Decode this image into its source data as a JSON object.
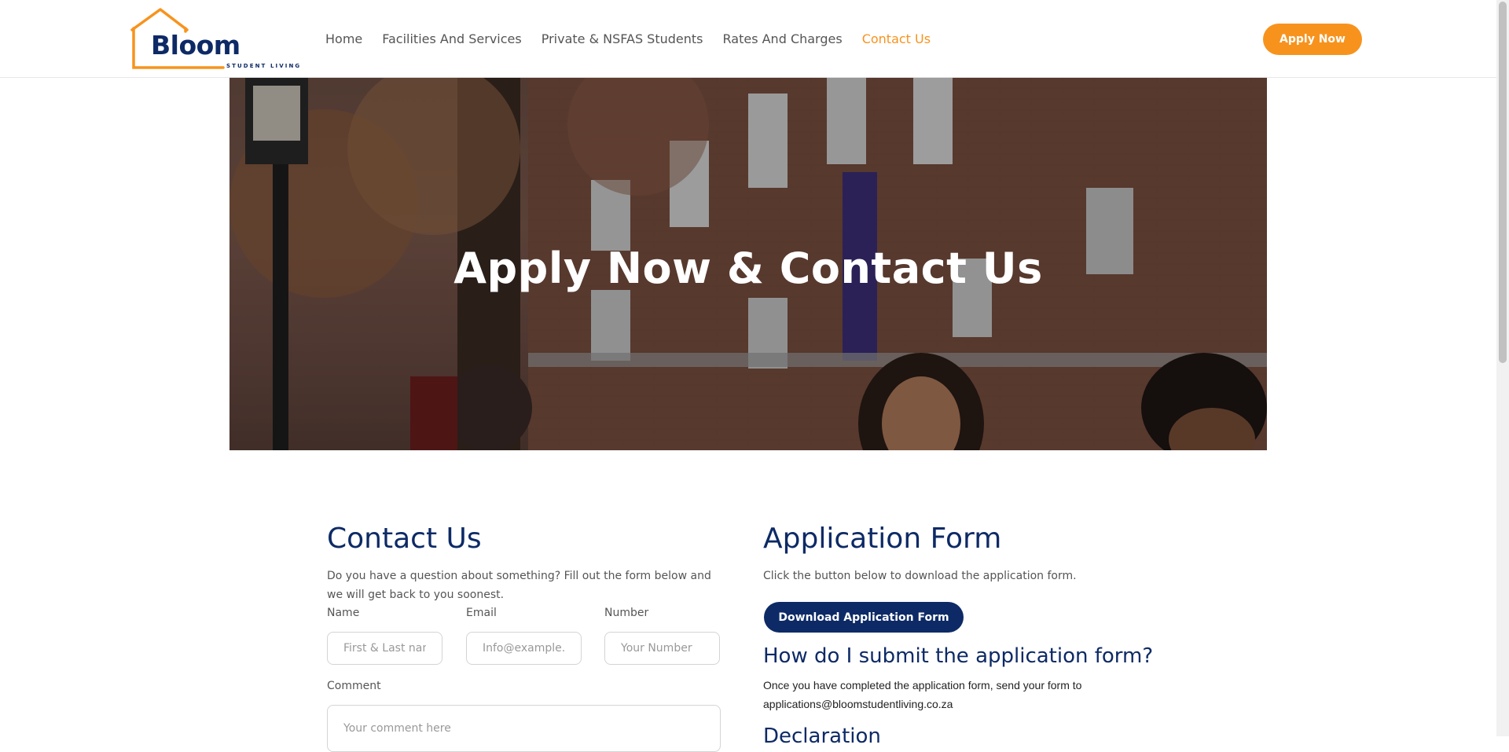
{
  "brand": {
    "name": "Bloom",
    "tagline": "STUDENT LIVING",
    "accent": "#f7931d",
    "navy": "#0d2a66"
  },
  "nav": {
    "items": [
      {
        "label": "Home"
      },
      {
        "label": "Facilities And Services"
      },
      {
        "label": "Private & NSFAS Students"
      },
      {
        "label": "Rates And Charges"
      },
      {
        "label": "Contact Us",
        "active": true
      }
    ],
    "cta_label": "Apply Now"
  },
  "hero": {
    "title": "Apply Now & Contact Us"
  },
  "contact": {
    "heading": "Contact Us",
    "intro": "Do you have a question about something? Fill out the form below and we will get back to you soonest.",
    "fields": {
      "name": {
        "label": "Name",
        "placeholder": "First & Last name"
      },
      "email": {
        "label": "Email",
        "placeholder": "Info@example.com"
      },
      "number": {
        "label": "Number",
        "placeholder": "Your Number"
      },
      "comment": {
        "label": "Comment",
        "placeholder": "Your comment here"
      }
    }
  },
  "application": {
    "heading": "Application Form",
    "intro": "Click the button below to download the application form.",
    "download_label": "Download Application Form",
    "submit_heading": "How do I submit the application form?",
    "submit_text_1": "Once you have completed the application form, send your form to",
    "submit_text_2": "applications@bloomstudentliving.co.za",
    "next_heading": "Declaration"
  }
}
